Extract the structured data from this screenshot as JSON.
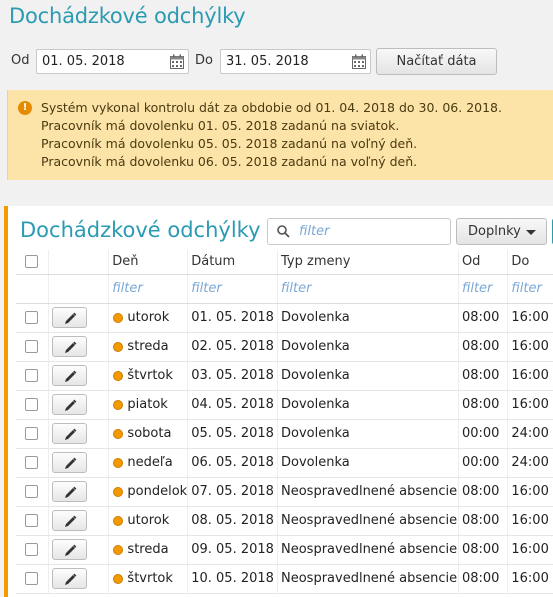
{
  "page": {
    "title": "Dochádzkové odchýlky"
  },
  "filters": {
    "from_label": "Od",
    "from_value": "01. 05. 2018",
    "to_label": "Do",
    "to_value": "31. 05. 2018",
    "load_button": "Načítať dáta"
  },
  "notice": {
    "icon": "info-icon",
    "lines": [
      "Systém vykonal kontrolu dát za obdobie od 01. 04. 2018 do 30. 06. 2018.",
      "Pracovník má dovolenku 01. 05. 2018 zadanú na sviatok.",
      "Pracovník má dovolenku 05. 05. 2018 zadanú na voľný deň.",
      "Pracovník má dovolenku 06. 05. 2018 zadanú na voľný deň."
    ]
  },
  "grid": {
    "title": "Dochádzkové odchýlky",
    "search_placeholder": "filter",
    "addons_button": "Doplnky",
    "columns": [
      "",
      "",
      "Deň",
      "Dátum",
      "Typ zmeny",
      "Od",
      "Do"
    ],
    "filter_placeholder": "filter",
    "rows": [
      {
        "day": "utorok",
        "date": "01. 05. 2018",
        "type": "Dovolenka",
        "from": "08:00",
        "to": "16:00"
      },
      {
        "day": "streda",
        "date": "02. 05. 2018",
        "type": "Dovolenka",
        "from": "08:00",
        "to": "16:00"
      },
      {
        "day": "štvrtok",
        "date": "03. 05. 2018",
        "type": "Dovolenka",
        "from": "08:00",
        "to": "16:00"
      },
      {
        "day": "piatok",
        "date": "04. 05. 2018",
        "type": "Dovolenka",
        "from": "08:00",
        "to": "16:00"
      },
      {
        "day": "sobota",
        "date": "05. 05. 2018",
        "type": "Dovolenka",
        "from": "00:00",
        "to": "24:00"
      },
      {
        "day": "nedeľa",
        "date": "06. 05. 2018",
        "type": "Dovolenka",
        "from": "00:00",
        "to": "24:00"
      },
      {
        "day": "pondelok",
        "date": "07. 05. 2018",
        "type": "Neospravedlnené absencie",
        "from": "08:00",
        "to": "16:00"
      },
      {
        "day": "utorok",
        "date": "08. 05. 2018",
        "type": "Neospravedlnené absencie",
        "from": "08:00",
        "to": "16:00"
      },
      {
        "day": "streda",
        "date": "09. 05. 2018",
        "type": "Neospravedlnené absencie",
        "from": "08:00",
        "to": "16:00"
      },
      {
        "day": "štvrtok",
        "date": "10. 05. 2018",
        "type": "Neospravedlnené absencie",
        "from": "08:00",
        "to": "16:00"
      }
    ]
  },
  "colors": {
    "accent": "#2a9bb3",
    "warning_bg": "#fce3a8",
    "status_dot": "#f39a00"
  }
}
